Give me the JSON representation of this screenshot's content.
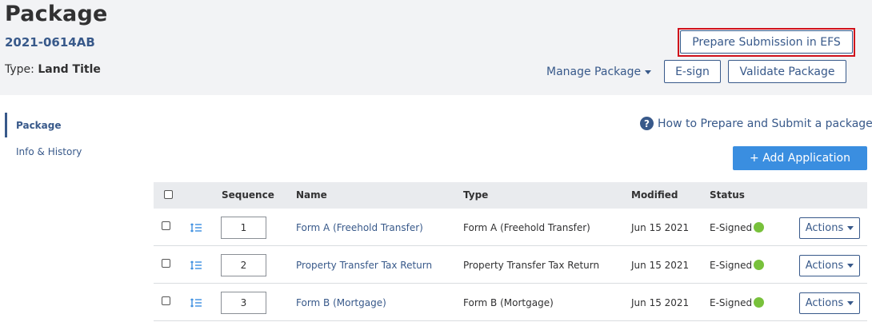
{
  "package": {
    "title": "Package",
    "number": "2021-0614AB",
    "type_label": "Type: ",
    "type_value": "Land Title"
  },
  "toolbar": {
    "prepare_label": "Prepare Submission in EFS",
    "manage_label": "Manage Package",
    "esign_label": "E-sign",
    "validate_label": "Validate Package"
  },
  "sidebar": {
    "items": [
      {
        "label": "Package"
      },
      {
        "label": "Info & History"
      }
    ]
  },
  "help": {
    "icon_text": "?",
    "label": "How to Prepare and Submit a package?"
  },
  "add_application_label": "+ Add Application",
  "table": {
    "columns": [
      "Sequence",
      "Name",
      "Type",
      "Modified",
      "Status"
    ],
    "rows": [
      {
        "sequence": "1",
        "name": "Form A (Freehold Transfer)",
        "type": "Form A (Freehold Transfer)",
        "modified": "Jun 15 2021",
        "status": "E-Signed",
        "actions": "Actions"
      },
      {
        "sequence": "2",
        "name": "Property Transfer Tax Return",
        "type": "Property Transfer Tax Return",
        "modified": "Jun 15 2021",
        "status": "E-Signed",
        "actions": "Actions"
      },
      {
        "sequence": "3",
        "name": "Form B (Mortgage)",
        "type": "Form B (Mortgage)",
        "modified": "Jun 15 2021",
        "status": "E-Signed",
        "actions": "Actions"
      }
    ]
  },
  "colors": {
    "primary": "#38598a",
    "accent": "#3a8ee0",
    "highlight": "#d0111b",
    "status_ok": "#78c13b"
  }
}
